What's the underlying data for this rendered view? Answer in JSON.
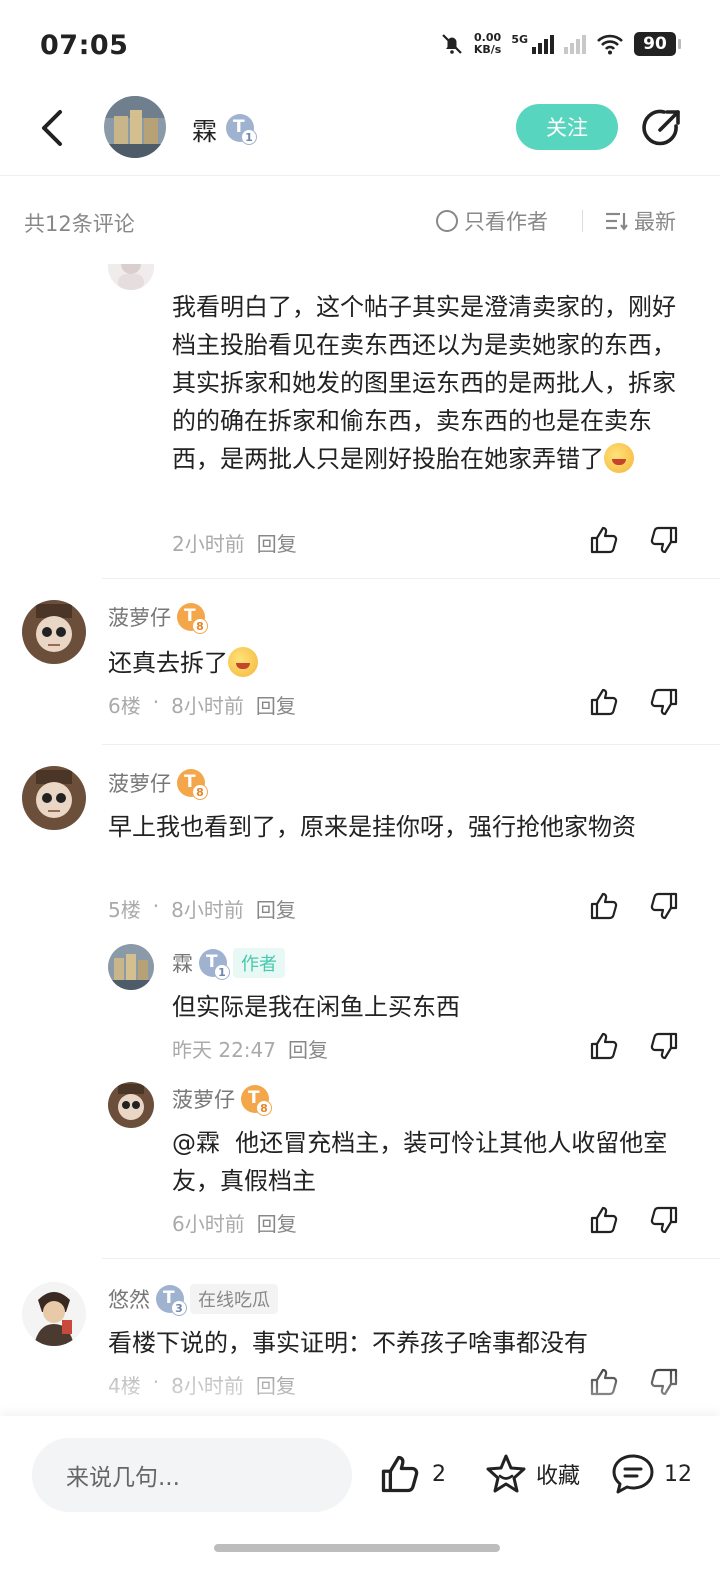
{
  "status_bar": {
    "time": "07:05",
    "net_speed_value": "0.00",
    "net_speed_unit": "KB/s",
    "network": "5G",
    "battery": "90"
  },
  "header": {
    "author_name": "霖",
    "author_level": "1",
    "follow_label": "关注"
  },
  "comments_bar": {
    "count_label": "共12条评论",
    "only_author_label": "只看作者",
    "sort_label": "最新"
  },
  "comments": [
    {
      "text": "我看明白了，这个帖子其实是澄清卖家的，刚好档主投胎看见在卖东西还以为是卖她家的东西，其实拆家和她发的图里运东西的是两批人，拆家的的确在拆家和偷东西，卖东西的也是在卖东西，是两批人只是刚好投胎在她家弄错了",
      "time": "2小时前",
      "reply": "回复"
    },
    {
      "user": "菠萝仔",
      "level": "8",
      "text": "还真去拆了",
      "floor": "6楼",
      "time": "8小时前",
      "reply": "回复"
    },
    {
      "user": "菠萝仔",
      "level": "8",
      "text": "早上我也看到了，原来是挂你呀，强行抢他家物资",
      "floor": "5楼",
      "time": "8小时前",
      "reply": "回复",
      "replies": [
        {
          "user": "霖",
          "level": "1",
          "tag": "作者",
          "text": "但实际是我在闲鱼上买东西",
          "time": "昨天 22:47",
          "reply": "回复"
        },
        {
          "user": "菠萝仔",
          "level": "8",
          "mention": "@霖",
          "text": "他还冒充档主，装可怜让其他人收留他室友，真假档主",
          "time": "6小时前",
          "reply": "回复"
        }
      ]
    },
    {
      "user": "悠然",
      "level": "3",
      "tag": "在线吃瓜",
      "text": "看楼下说的，事实证明：不养孩子啥事都没有",
      "floor": "4楼",
      "time": "8小时前",
      "reply": "回复"
    }
  ],
  "floor_separator": "·",
  "bottom_bar": {
    "input_placeholder": "来说几句...",
    "like_count": "2",
    "favorite_label": "收藏",
    "comment_count": "12"
  },
  "colors": {
    "accent": "#58d5be",
    "level_orange": "#f3a64a",
    "level_blue": "#9fb2cf"
  }
}
